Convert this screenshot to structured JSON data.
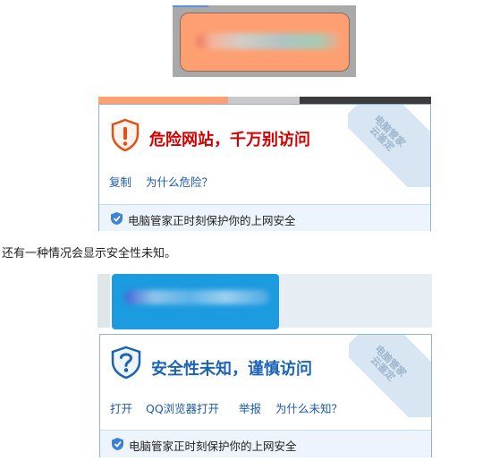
{
  "popups": [
    {
      "title": "危险网站，千万别访问",
      "title_color": "#d40000",
      "links": [
        "复制",
        "为什么危险？"
      ],
      "footer": "电脑管家正时刻保护你的上网安全",
      "seal": "电脑管家\n云鉴定"
    },
    {
      "title": "安全性未知，谨慎访问",
      "title_color": "#1b64b5",
      "links": [
        "打开",
        "QQ浏览器打开",
        "举报",
        "为什么未知？"
      ],
      "footer": "电脑管家正时刻保护你的上网安全",
      "seal": "电脑管家\n云鉴定"
    }
  ],
  "sentence": "还有一种情况会显示安全性未知。",
  "icons": [
    "warning-shield-icon",
    "question-shield-icon",
    "shield-check-icon"
  ],
  "colors": {
    "bubble1": "#fe9f72",
    "bubble2": "#1c9be0",
    "link": "#1e5aa8"
  }
}
